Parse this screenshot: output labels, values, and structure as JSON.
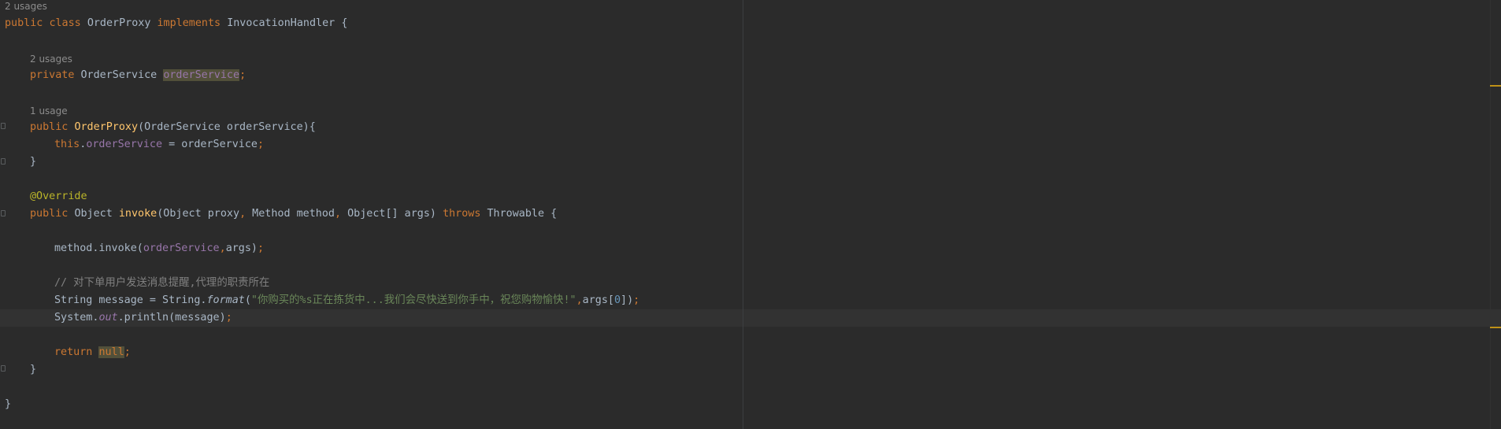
{
  "usages": {
    "class": "2 usages",
    "field": "2 usages",
    "constructor": "1 usage"
  },
  "code": {
    "l1": {
      "kw1": "public",
      "kw2": "class",
      "name": "OrderProxy",
      "kw3": "implements",
      "iface": "InvocationHandler",
      "brace": "{"
    },
    "l2": {
      "kw": "private",
      "type": "OrderService",
      "field": "orderService",
      "semi": ";"
    },
    "l3": {
      "kw": "public",
      "name": "OrderProxy",
      "params": "(OrderService orderService){"
    },
    "l4": {
      "kw": "this",
      "dot": ".",
      "field": "orderService",
      "rest": " = orderService",
      "semi": ";"
    },
    "l5": {
      "brace": "}"
    },
    "l6": {
      "ann": "@Override"
    },
    "l7": {
      "kw": "public",
      "type": "Object",
      "name": "invoke",
      "p1": "(Object proxy",
      "c1": ",",
      "p2": " Method method",
      "c2": ",",
      "p3": " Object[] args) ",
      "kw2": "throws",
      "rest": " Throwable {"
    },
    "l8": {
      "pre": "method.invoke(",
      "field": "orderService",
      "comma": ",",
      "post": "args)",
      "semi": ";"
    },
    "l9": {
      "comment": "// 对下单用户发送消息提醒,代理的职责所在"
    },
    "l10": {
      "pre": "String message = String.",
      "method": "format",
      "open": "(",
      "str": "\"你购买的%s正在拣货中...我们会尽快送到你手中，祝您购物愉快!\"",
      "comma": ",",
      "args": "args[",
      "num": "0",
      "close": "])",
      "semi": ";"
    },
    "l11": {
      "pre": "System.",
      "static": "out",
      "post": ".println(message)",
      "semi": ";"
    },
    "l12": {
      "kw": "return",
      "val": "null",
      "semi": ";"
    },
    "l13": {
      "brace": "}"
    },
    "l14": {
      "brace": "}"
    }
  },
  "colors": {
    "background": "#2b2b2b",
    "keyword": "#cc7832",
    "method_decl": "#ffc66d",
    "field": "#9876aa",
    "annotation": "#bbb529",
    "string": "#6a8759",
    "number": "#6897bb",
    "comment": "#808080",
    "text": "#a9b7c6"
  }
}
